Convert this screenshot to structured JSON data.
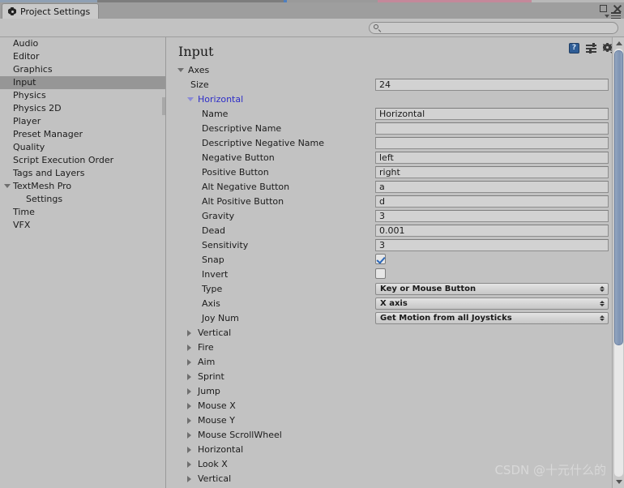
{
  "window": {
    "tab_label": "Project Settings",
    "tab_icon": "gear-icon",
    "maximize_label": "Maximize",
    "close_label": "Close",
    "menu_label": "Window Menu"
  },
  "search": {
    "value": "",
    "placeholder": ""
  },
  "sidebar": {
    "items": [
      {
        "label": "Audio",
        "selected": false,
        "indent": false,
        "foldout": ""
      },
      {
        "label": "Editor",
        "selected": false,
        "indent": false,
        "foldout": ""
      },
      {
        "label": "Graphics",
        "selected": false,
        "indent": false,
        "foldout": ""
      },
      {
        "label": "Input",
        "selected": true,
        "indent": false,
        "foldout": ""
      },
      {
        "label": "Physics",
        "selected": false,
        "indent": false,
        "foldout": ""
      },
      {
        "label": "Physics 2D",
        "selected": false,
        "indent": false,
        "foldout": ""
      },
      {
        "label": "Player",
        "selected": false,
        "indent": false,
        "foldout": ""
      },
      {
        "label": "Preset Manager",
        "selected": false,
        "indent": false,
        "foldout": ""
      },
      {
        "label": "Quality",
        "selected": false,
        "indent": false,
        "foldout": ""
      },
      {
        "label": "Script Execution Order",
        "selected": false,
        "indent": false,
        "foldout": ""
      },
      {
        "label": "Tags and Layers",
        "selected": false,
        "indent": false,
        "foldout": ""
      },
      {
        "label": "TextMesh Pro",
        "selected": false,
        "indent": false,
        "foldout": "expanded"
      },
      {
        "label": "Settings",
        "selected": false,
        "indent": true,
        "foldout": ""
      },
      {
        "label": "Time",
        "selected": false,
        "indent": false,
        "foldout": ""
      },
      {
        "label": "VFX",
        "selected": false,
        "indent": false,
        "foldout": ""
      }
    ]
  },
  "panel": {
    "title": "Input",
    "help_icon": "help-book-icon",
    "preset_icon": "preset-icon",
    "gear_icon": "gear-icon",
    "rows": [
      {
        "kind": "foldout",
        "label": "Axes",
        "state": "expanded",
        "indent": 0,
        "blue": false
      },
      {
        "kind": "text",
        "label": "Size",
        "value": "24",
        "indent": 1
      },
      {
        "kind": "foldout",
        "label": "Horizontal",
        "state": "expanded",
        "indent": 1,
        "blue": true
      },
      {
        "kind": "text",
        "label": "Name",
        "value": "Horizontal",
        "indent": 2
      },
      {
        "kind": "text",
        "label": "Descriptive Name",
        "value": "",
        "indent": 2
      },
      {
        "kind": "text",
        "label": "Descriptive Negative Name",
        "value": "",
        "indent": 2
      },
      {
        "kind": "text",
        "label": "Negative Button",
        "value": "left",
        "indent": 2
      },
      {
        "kind": "text",
        "label": "Positive Button",
        "value": "right",
        "indent": 2
      },
      {
        "kind": "text",
        "label": "Alt Negative Button",
        "value": "a",
        "indent": 2
      },
      {
        "kind": "text",
        "label": "Alt Positive Button",
        "value": "d",
        "indent": 2
      },
      {
        "kind": "text",
        "label": "Gravity",
        "value": "3",
        "indent": 2
      },
      {
        "kind": "text",
        "label": "Dead",
        "value": "0.001",
        "indent": 2
      },
      {
        "kind": "text",
        "label": "Sensitivity",
        "value": "3",
        "indent": 2
      },
      {
        "kind": "check",
        "label": "Snap",
        "checked": true,
        "indent": 2
      },
      {
        "kind": "check",
        "label": "Invert",
        "checked": false,
        "indent": 2
      },
      {
        "kind": "select",
        "label": "Type",
        "value": "Key or Mouse Button",
        "indent": 2
      },
      {
        "kind": "select",
        "label": "Axis",
        "value": "X axis",
        "indent": 2
      },
      {
        "kind": "select",
        "label": "Joy Num",
        "value": "Get Motion from all Joysticks",
        "indent": 2
      },
      {
        "kind": "foldout",
        "label": "Vertical",
        "state": "collapsed",
        "indent": 1,
        "blue": false
      },
      {
        "kind": "foldout",
        "label": "Fire",
        "state": "collapsed",
        "indent": 1,
        "blue": false
      },
      {
        "kind": "foldout",
        "label": "Aim",
        "state": "collapsed",
        "indent": 1,
        "blue": false
      },
      {
        "kind": "foldout",
        "label": "Sprint",
        "state": "collapsed",
        "indent": 1,
        "blue": false
      },
      {
        "kind": "foldout",
        "label": "Jump",
        "state": "collapsed",
        "indent": 1,
        "blue": false
      },
      {
        "kind": "foldout",
        "label": "Mouse X",
        "state": "collapsed",
        "indent": 1,
        "blue": false
      },
      {
        "kind": "foldout",
        "label": "Mouse Y",
        "state": "collapsed",
        "indent": 1,
        "blue": false
      },
      {
        "kind": "foldout",
        "label": "Mouse ScrollWheel",
        "state": "collapsed",
        "indent": 1,
        "blue": false
      },
      {
        "kind": "foldout",
        "label": "Horizontal",
        "state": "collapsed",
        "indent": 1,
        "blue": false
      },
      {
        "kind": "foldout",
        "label": "Look X",
        "state": "collapsed",
        "indent": 1,
        "blue": false
      },
      {
        "kind": "foldout",
        "label": "Vertical",
        "state": "collapsed",
        "indent": 1,
        "blue": false
      }
    ]
  },
  "scrollbar": {
    "up_label": "Scroll up",
    "down_label": "Scroll down"
  },
  "watermark": {
    "text": "CSDN @十元什么的"
  },
  "colors": {
    "background": "#c2c2c2",
    "selected_row": "#969696",
    "accent_blue": "#2d2dc8",
    "checkbox_check": "#2a66b8",
    "scrollbar_thumb": "#7f94b4"
  }
}
